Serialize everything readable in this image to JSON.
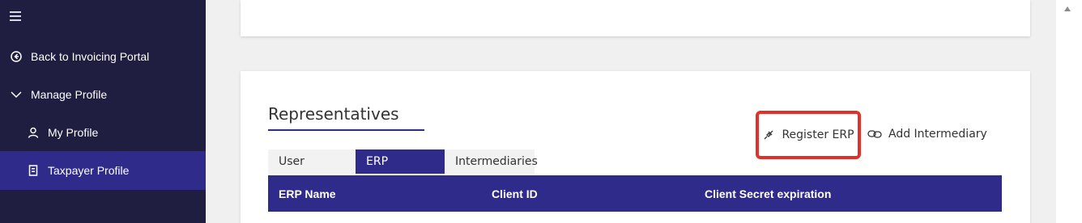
{
  "sidebar": {
    "items": [
      {
        "label": "Back to Invoicing Portal",
        "icon": "arrow-left-circle-icon"
      },
      {
        "label": "Manage Profile",
        "icon": "chevron-down-icon"
      },
      {
        "label": "My Profile",
        "icon": "person-icon"
      },
      {
        "label": "Taxpayer Profile",
        "icon": "building-icon",
        "active": true
      }
    ]
  },
  "main": {
    "section_title": "Representatives",
    "actions": {
      "register_erp": "Register ERP",
      "add_intermediary": "Add Intermediary"
    },
    "tabs": [
      {
        "label": "User"
      },
      {
        "label": "ERP",
        "active": true
      },
      {
        "label": "Intermediaries"
      }
    ],
    "table": {
      "headers": [
        "ERP Name",
        "Client ID",
        "Client Secret expiration"
      ]
    }
  },
  "colors": {
    "sidebar_bg": "#1f1d40",
    "accent": "#2e2b8a",
    "highlight_box": "#e0312b"
  }
}
